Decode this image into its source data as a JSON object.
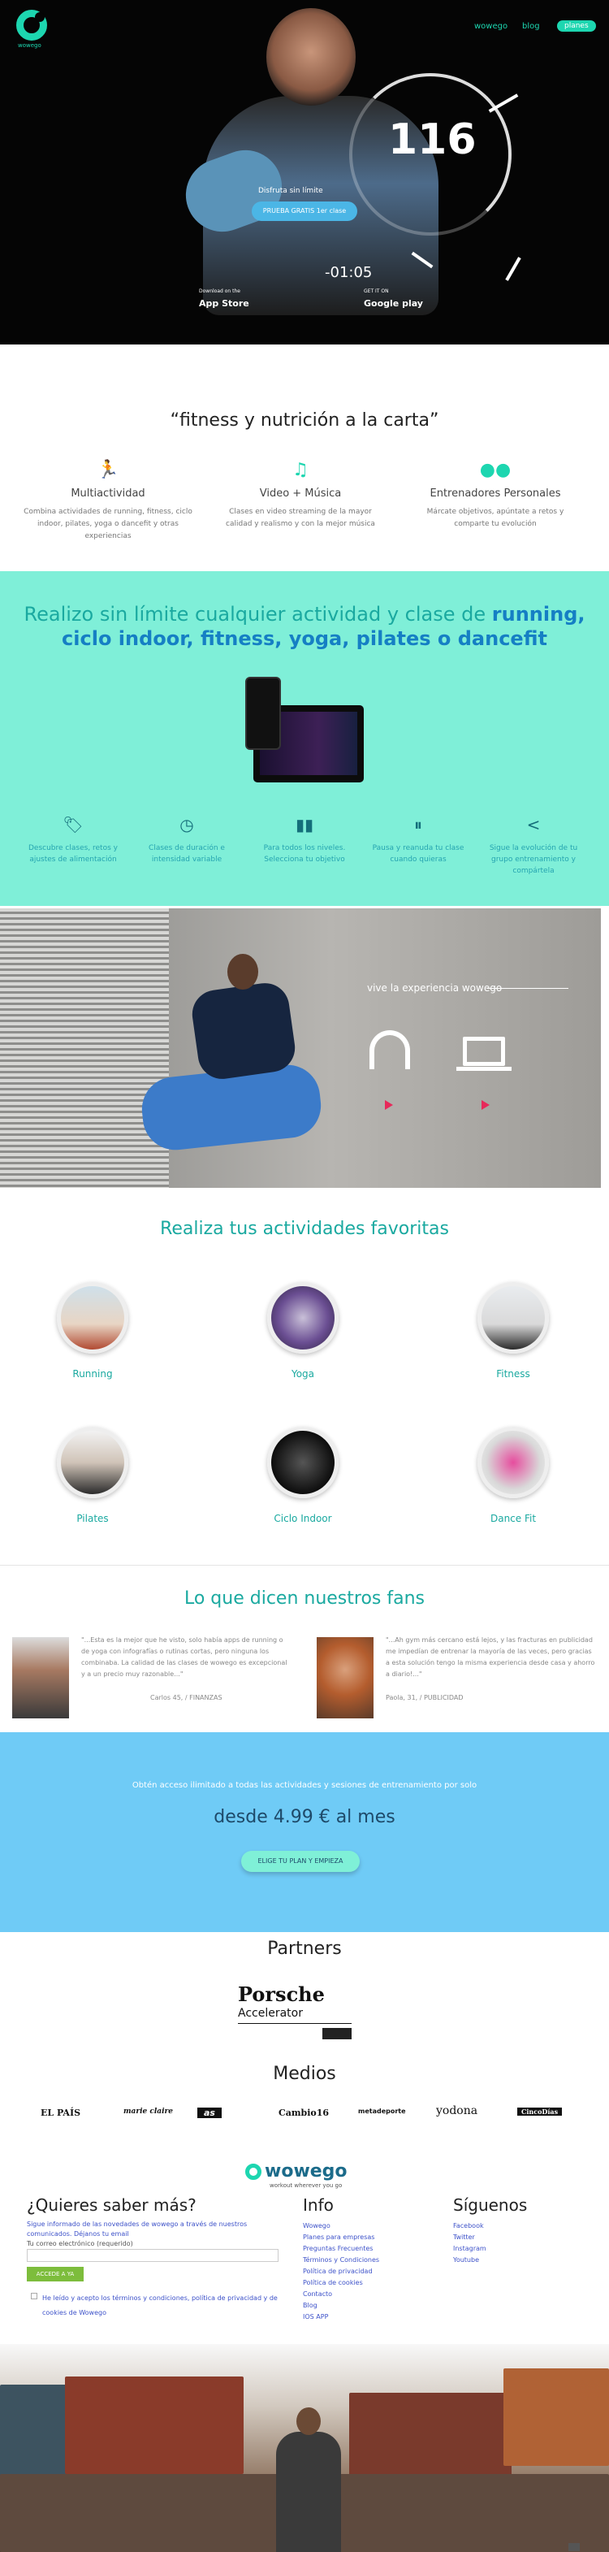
{
  "hero": {
    "logo_sub": "wowego",
    "nav": [
      "wowego",
      "blog"
    ],
    "nav_cta": "planes",
    "dial_number": "116",
    "small_text": "Disfruta sin límite",
    "cta": "PRUEBA GRATIS 1er clase",
    "time": "-01:05",
    "appstore_small": "Download on the",
    "appstore": "App Store",
    "googleplay_small": "GET IT ON",
    "googleplay": "Google play"
  },
  "intro": {
    "title": "“fitness y nutrición a la carta”",
    "features": [
      {
        "icon": "runner-icon",
        "title": "Multiactividad",
        "desc": "Combina actividades de running, fitness, ciclo indoor, pilates, yoga o dancefit y otras experiencias"
      },
      {
        "icon": "music-video-icon",
        "title": "Video + Música",
        "desc": "Clases en video streaming de la mayor calidad y realismo y con la mejor música"
      },
      {
        "icon": "trainers-icon",
        "title": "Entrenadores Personales",
        "desc": "Márcate objetivos, apúntate a retos y comparte tu evolución"
      }
    ]
  },
  "teal": {
    "headline_a": "Realizo sin límite cualquier actividad y clase de",
    "headline_b": "running,",
    "headline_c": "ciclo indoor, fitness, yoga, pilates o dancefit",
    "features": [
      {
        "icon": "tag-icon",
        "text": "Descubre clases, retos y ajustes de alimentación"
      },
      {
        "icon": "clock-icon",
        "text": "Clases de duración e intensidad variable"
      },
      {
        "icon": "bar-chart-icon",
        "text": "Para todos los niveles. Selecciona tu objetivo"
      },
      {
        "icon": "pause-icon",
        "text": "Pausa y reanuda tu clase cuando quieras"
      },
      {
        "icon": "share-icon",
        "text": "Sigue la evolución de tu grupo entrenamiento y compártela"
      }
    ]
  },
  "runner": {
    "text": "vive la experiencia wowego"
  },
  "activities": {
    "title": "Realiza tus actividades favoritas",
    "items": [
      "Running",
      "Yoga",
      "Fitness",
      "Pilates",
      "Ciclo Indoor",
      "Dance Fit"
    ]
  },
  "fans": {
    "title": "Lo que dicen nuestros fans",
    "q1": "\"...Esta es la mejor que he visto, solo había apps de running o de yoga con infografías o rutinas cortas, pero ninguna los combinaba. La calidad de las clases de wowego es excepcional y a un precio muy razonable...\"",
    "n1": "Carlos 45, / FINANZAS",
    "q2": "\"...Ah gym más cercano está lejos, y las fracturas en publicidad me impedían de entrenar la mayoría de las veces, pero gracias a esta solución tengo la misma experiencia desde casa y ahorro a diario!...\"",
    "n2": "Paola, 31, / PUBLICIDAD"
  },
  "pricing": {
    "small": "Obtén acceso ilimitado a todas las actividades y sesiones de entrenamiento por solo",
    "price": "desde 4.99 € al mes",
    "cta": "ELIGE TU PLAN Y EMPIEZA"
  },
  "partners": {
    "title": "Partners",
    "porsche": "Porsche",
    "accel": "Accelerator"
  },
  "medios": {
    "title": "Medios",
    "logos": [
      "EL PAÍS",
      "marie claire",
      "as",
      "Cambio16",
      "metadeporte",
      "yodona",
      "CincoDías"
    ]
  },
  "footer": {
    "logo": "wowego",
    "logo_sub": "workout wherever you go",
    "q_title": "¿Quieres saber más?",
    "q_text": "Sigue informado de las novedades de wowego a través de nuestros comunicados. Déjanos tu email",
    "q_email": "Tu correo electrónico (requerido)",
    "q_btn": "ACCEDE A YA",
    "q_terms": "He leído y acepto los términos y condiciones, política de privacidad y de cookies de Wowego",
    "info_title": "Info",
    "info_links": [
      "Wowego",
      "Planes para empresas",
      "Preguntas Frecuentes",
      "Términos y Condiciones",
      "Política de privacidad",
      "Política de cookies",
      "Contacto",
      "Blog",
      "IOS APP"
    ],
    "follow_title": "Síguenos",
    "follow_links": [
      "Facebook",
      "Twitter",
      "Instagram",
      "Youtube"
    ]
  },
  "colors": {
    "brand_teal": "#1dd6b0",
    "teal_bg": "#7fefd8",
    "blue_bg": "#6fcbf6",
    "accent_blue": "#157fc4"
  }
}
